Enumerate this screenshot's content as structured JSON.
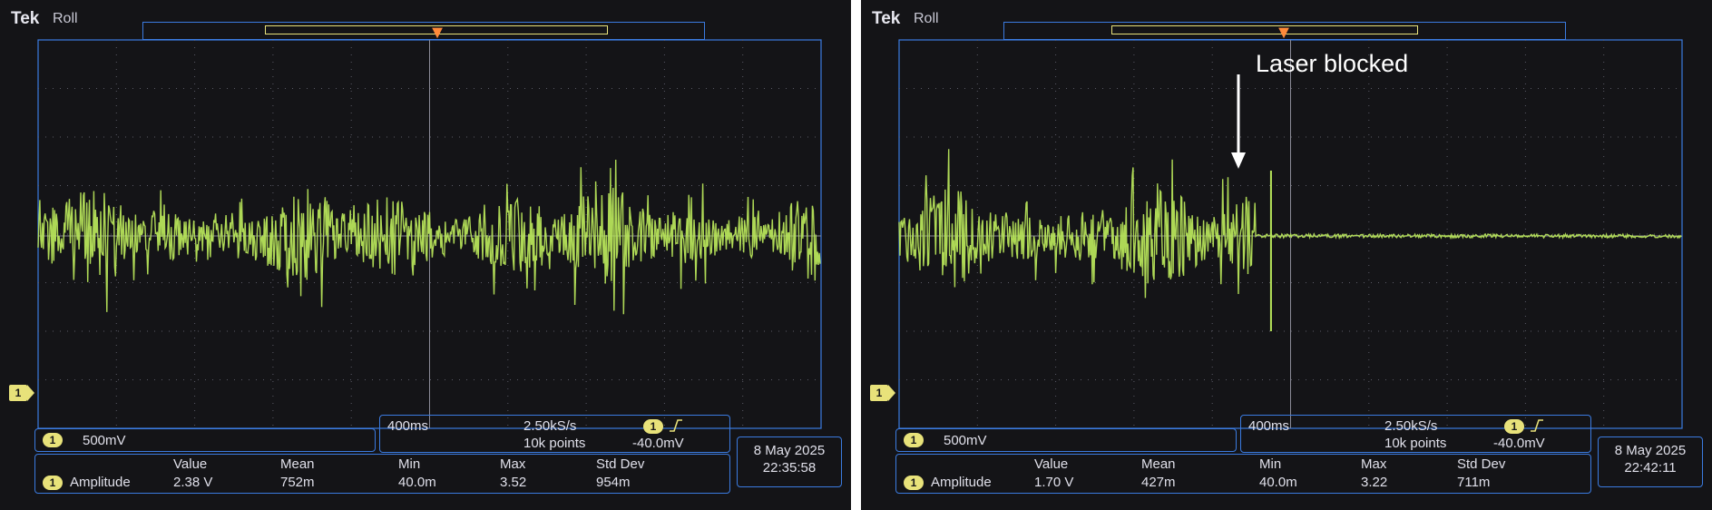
{
  "screens": [
    {
      "brand": "Tek",
      "mode": "Roll",
      "channel_number": "1",
      "volts_per_div": "500mV",
      "time_per_div": "400ms",
      "sample_rate": "2.50kS/s",
      "record_length": "10k points",
      "trigger_level": "-40.0mV",
      "trigger_slope_icon": "rising-edge-icon",
      "date": "8 May 2025",
      "time": "22:35:58",
      "measurement": {
        "name": "Amplitude",
        "headers": [
          "Value",
          "Mean",
          "Min",
          "Max",
          "Std Dev"
        ],
        "values": [
          "2.38 V",
          "752m",
          "40.0m",
          "3.52",
          "954m"
        ]
      },
      "trace_color": "#b6e35a",
      "grid_color": "#5a5a66",
      "accent_color": "#3b7be0"
    },
    {
      "brand": "Tek",
      "mode": "Roll",
      "channel_number": "1",
      "volts_per_div": "500mV",
      "time_per_div": "400ms",
      "sample_rate": "2.50kS/s",
      "record_length": "10k points",
      "trigger_level": "-40.0mV",
      "trigger_slope_icon": "rising-edge-icon",
      "date": "8 May 2025",
      "time": "22:42:11",
      "measurement": {
        "name": "Amplitude",
        "headers": [
          "Value",
          "Mean",
          "Min",
          "Max",
          "Std Dev"
        ],
        "values": [
          "1.70 V",
          "427m",
          "40.0m",
          "3.22",
          "711m"
        ]
      },
      "trace_color": "#b6e35a",
      "grid_color": "#5a5a66",
      "accent_color": "#3b7be0"
    }
  ],
  "annotation": {
    "text": "Laser blocked",
    "color": "#ffffff"
  }
}
